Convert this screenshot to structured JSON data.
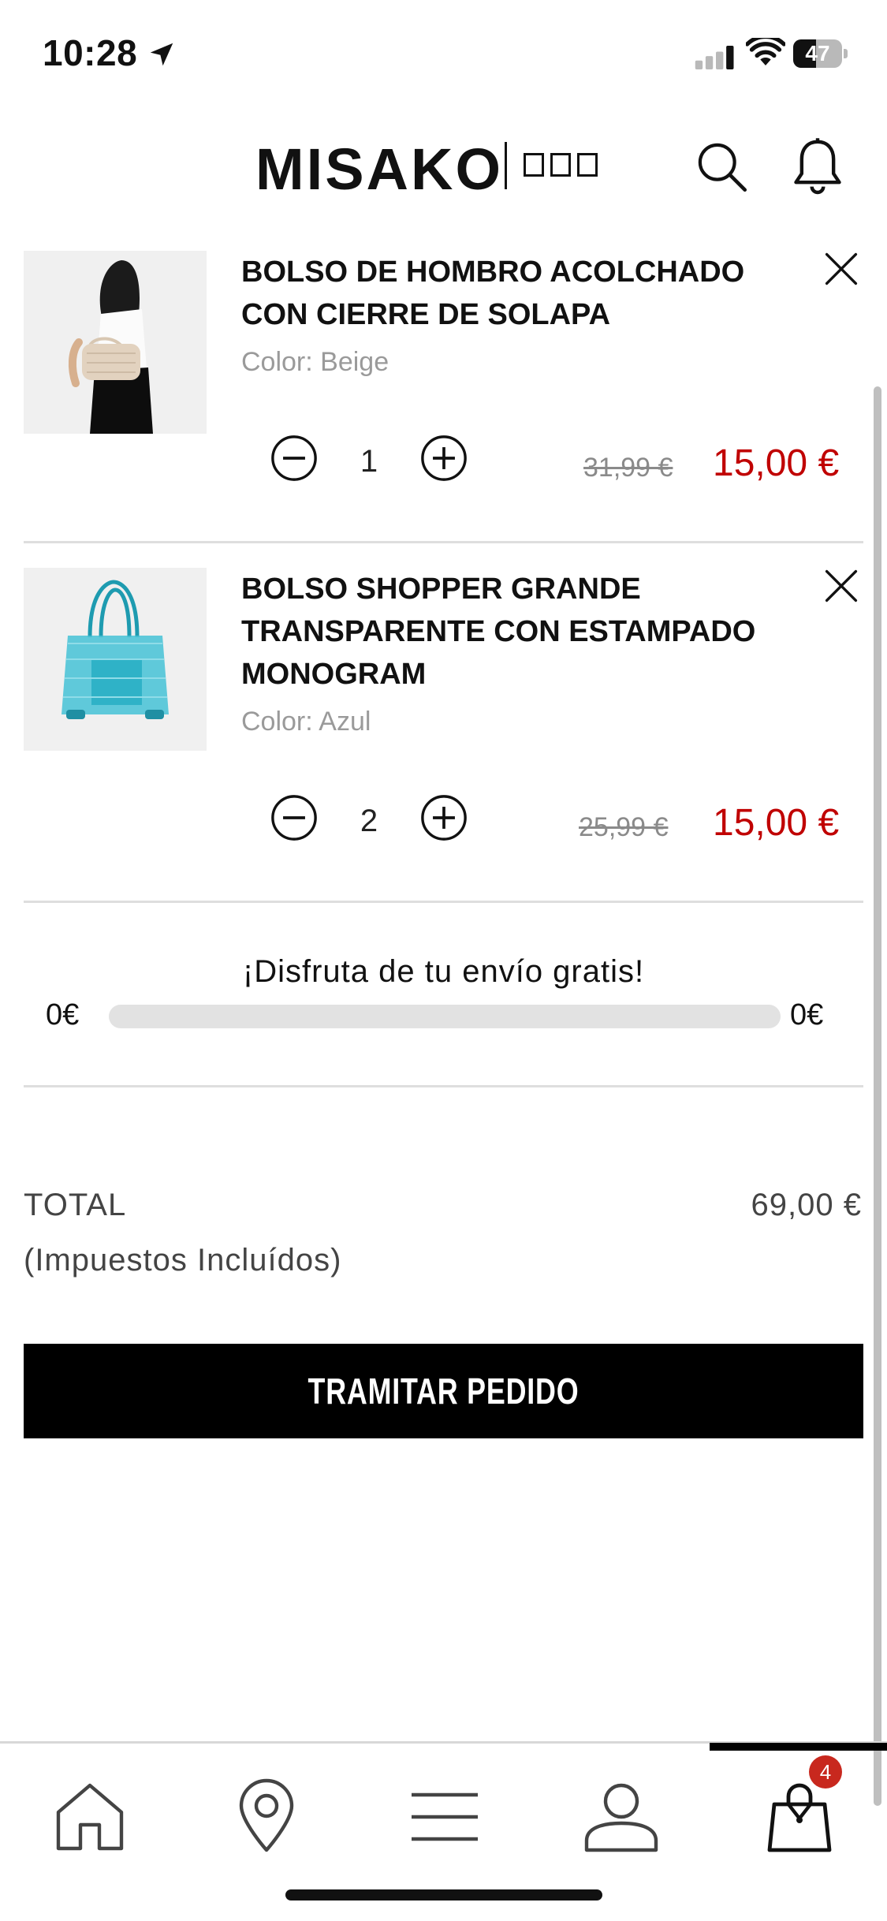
{
  "status_bar": {
    "time": "10:28",
    "battery_level": "47",
    "battery_fraction": 0.47,
    "icons": [
      "location-arrow-icon",
      "cellular-signal-icon",
      "wifi-icon",
      "battery-icon"
    ]
  },
  "header": {
    "brand": "MISAKO",
    "icons": [
      "search-icon",
      "bell-icon"
    ]
  },
  "cart": {
    "items": [
      {
        "title": "BOLSO DE HOMBRO ACOLCHADO CON CIERRE DE SOLAPA",
        "color_label": "Color:",
        "color_value": "Beige",
        "quantity": "1",
        "price_old": "31,99 €",
        "price_new": "15,00 €"
      },
      {
        "title": "BOLSO SHOPPER GRANDE TRANSPARENTE CON ESTAMPADO MONOGRAM",
        "color_label": "Color:",
        "color_value": "Azul",
        "quantity": "2",
        "price_old": "25,99 €",
        "price_new": "15,00 €"
      }
    ]
  },
  "shipping": {
    "message": "¡Disfruta de tu envío gratis!",
    "min_label": "0€",
    "max_label": "0€",
    "progress": 0
  },
  "summary": {
    "total_label": "TOTAL",
    "total_value": "69,00 €",
    "tax_note": "(Impuestos Incluídos)"
  },
  "checkout": {
    "button_label": "TRAMITAR PEDIDO"
  },
  "tabbar": {
    "items": [
      "home-icon",
      "location-pin-icon",
      "menu-icon",
      "account-icon",
      "shopping-bag-icon"
    ],
    "active": "shopping-bag-icon",
    "cart_badge": "4"
  },
  "colors": {
    "sale_price": "#c00000",
    "badge": "#c8281e",
    "button": "#000000"
  }
}
